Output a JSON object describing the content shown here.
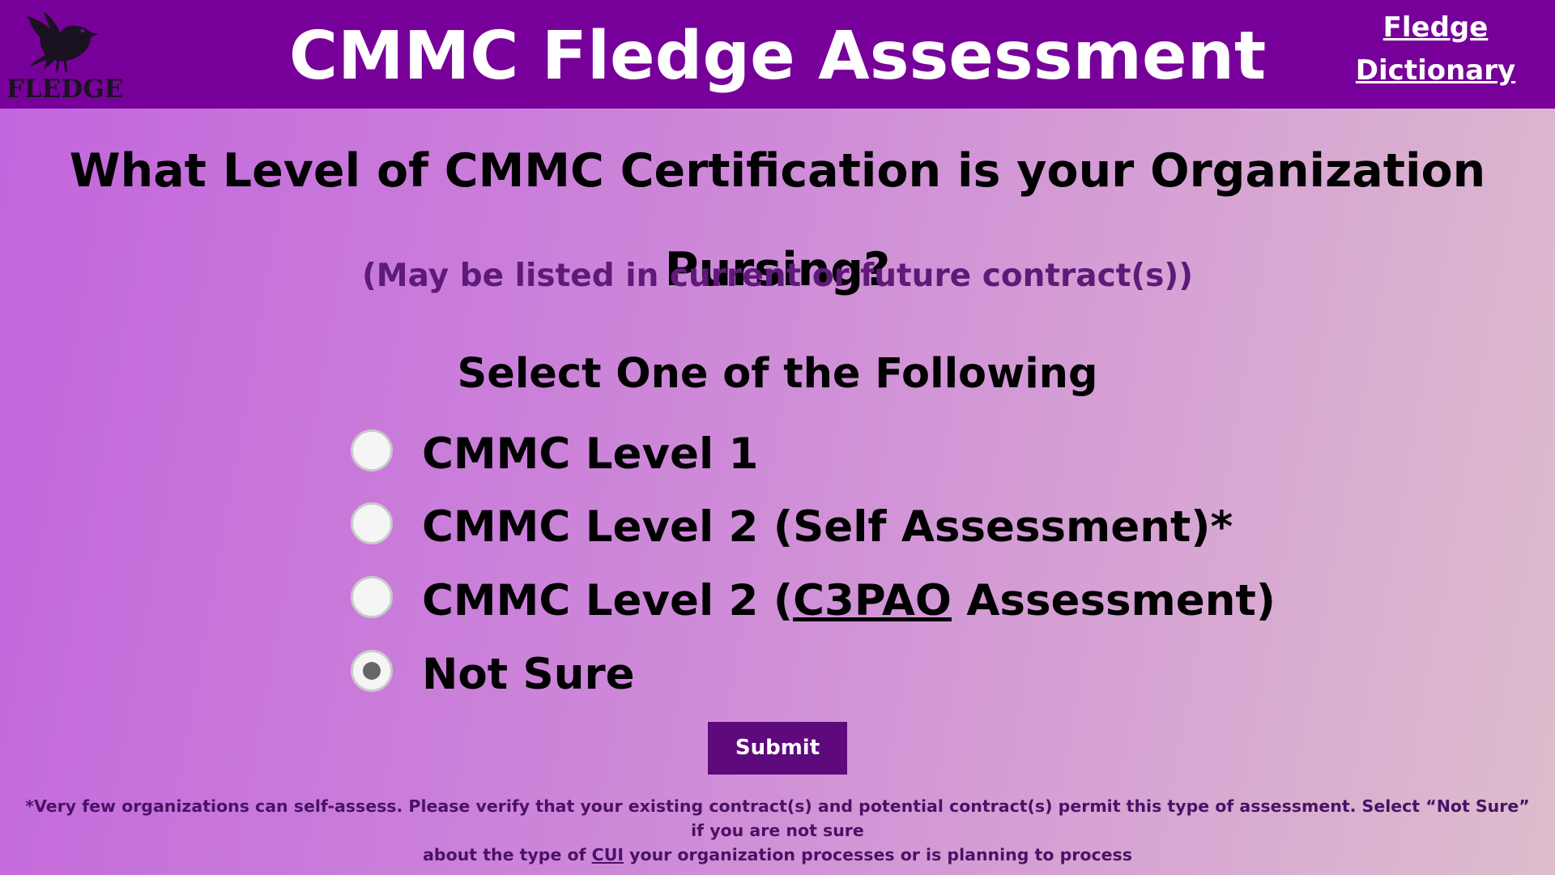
{
  "header": {
    "logo_text": "FLEDGE",
    "title": "CMMC Fledge Assessment",
    "dictionary_link": {
      "line1": "Fledge",
      "line2": "Dictionary"
    }
  },
  "question": {
    "line1": "What Level of CMMC Certification is your Organization",
    "line2": "Pursing?",
    "subtitle": "(May be listed in current or future contract(s))"
  },
  "select_heading": "Select One of the Following",
  "options": [
    {
      "label": "CMMC Level 1",
      "selected": false
    },
    {
      "label": "CMMC Level 2 (Self Assessment)*",
      "selected": false
    },
    {
      "label_prefix": "CMMC Level 2 (",
      "label_link": "C3PAO",
      "label_suffix": " Assessment)",
      "selected": false
    },
    {
      "label": "Not Sure",
      "selected": true
    }
  ],
  "submit_label": "Submit",
  "footnote": {
    "line1": "*Very few organizations can self-assess. Please verify that your existing contract(s) and potential contract(s) permit this type of assessment. Select “Not Sure” if you are not sure",
    "line2_prefix": "about the type of ",
    "line2_link": "CUI",
    "line2_suffix": " your organization processes or is planning to process"
  },
  "colors": {
    "header_bg": "#77009a",
    "submit_bg": "#5e0a7c",
    "subtitle_text": "#5e1a78"
  }
}
